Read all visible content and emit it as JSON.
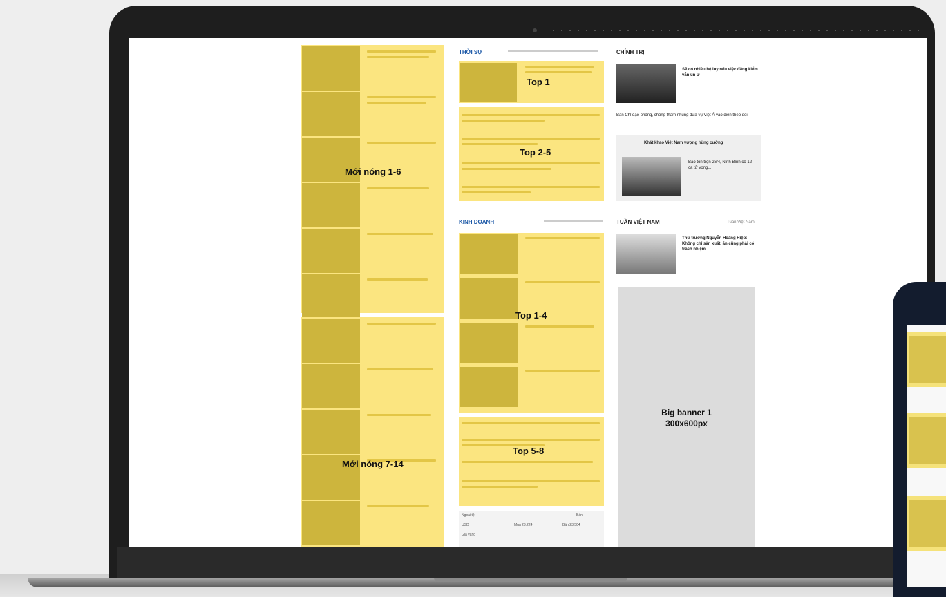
{
  "labels": {
    "moi_nong_1": "Mới nóng 1-6",
    "moi_nong_2": "Mới nóng 7-14",
    "top1": "Top 1",
    "top25": "Top 2-5",
    "top14": "Top 1-4",
    "top58": "Top 5-8",
    "banner_line1": "Big banner 1",
    "banner_line2": "300x600px"
  },
  "sections": {
    "thoi_su": "THỜI SỰ",
    "kinh_doanh": "KINH DOANH",
    "chinh_tri": "CHÍNH TRỊ",
    "tuan_viet_nam": "TUẦN VIỆT NAM"
  },
  "chinh_tri": {
    "headline": "Sẽ có nhiều hệ lụy nếu việc đăng kiểm vẫn ùn ứ",
    "sub": "Ban Chỉ đạo phòng, chống tham nhũng đưa vụ Việt Á vào diện theo dõi",
    "feature_title": "Khát khao Việt Nam vượng hùng cường",
    "feature_text": "Bảo tồn trọn 26/4, Ninh Bình có 12 ca tử vong..."
  },
  "tuan_viet_nam": {
    "right_label": "Tuần Việt Nam",
    "headline": "Thứ trưởng Nguyễn Hoàng Hiệp: Không chỉ sản xuất, ăn cũng phải có trách nhiệm"
  },
  "rates": {
    "h1": "Ngoại tệ",
    "h2": "Mua",
    "h3": "Bán",
    "code": "USD",
    "buy": "Mua 23.224",
    "sell": "Bán 23.504",
    "row2": "Giá vàng"
  },
  "colors": {
    "highlight": "#fbe580",
    "bezel": "#1e1e1e",
    "banner": "#dcdcdc"
  }
}
